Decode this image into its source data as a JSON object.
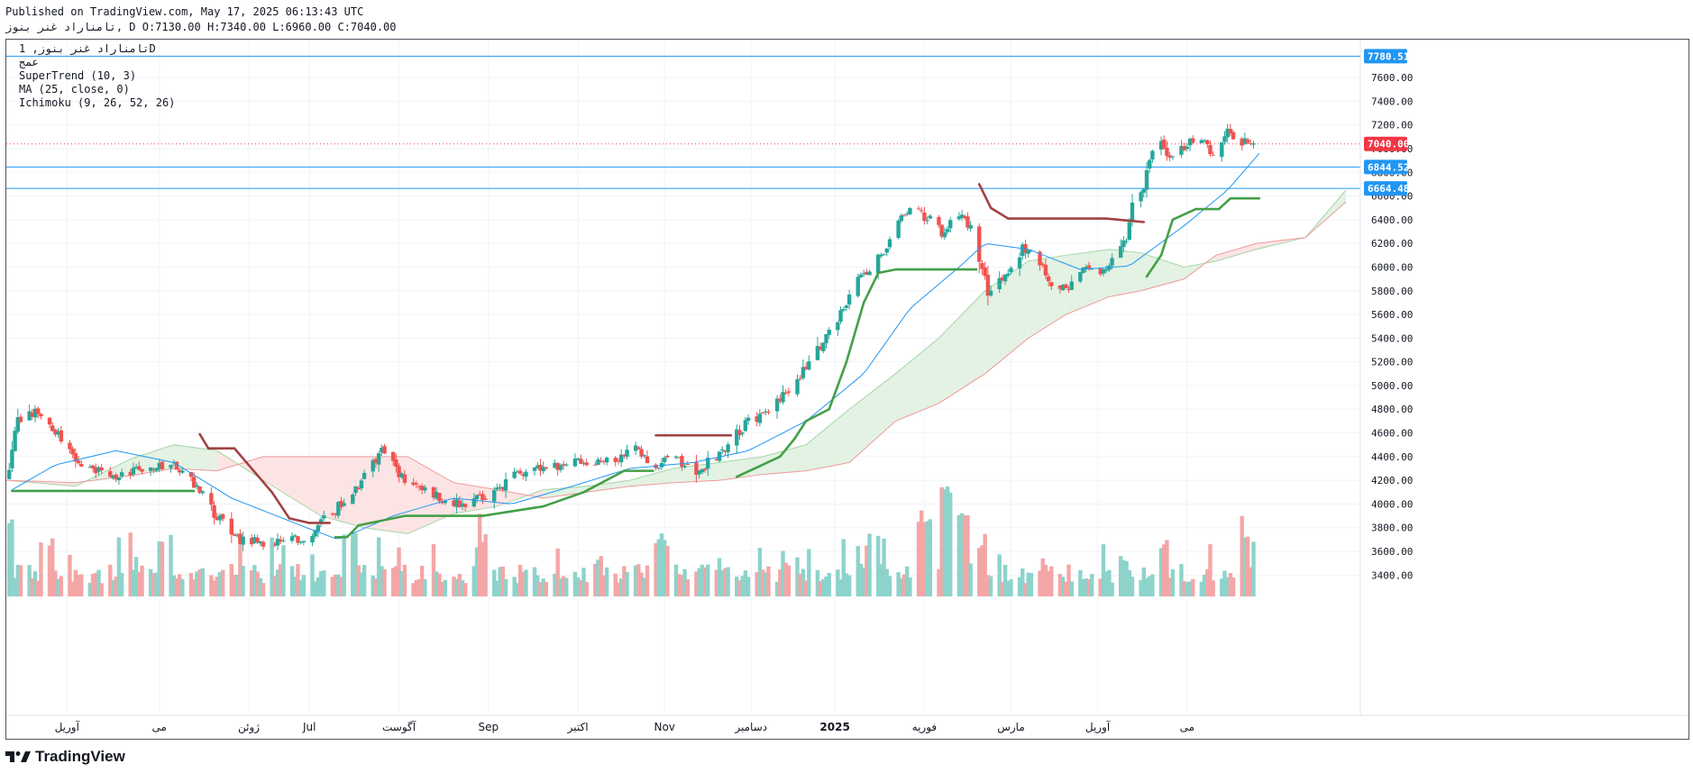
{
  "header": {
    "published": "Published on TradingView.com, May 17, 2025 06:13:43 UTC",
    "ohlc": "تامناراد غنر بنوز, D O:7130.00 H:7340.00 L:6960.00 C:7040.00"
  },
  "legend": {
    "symbol": "تامناراد غنر بنوز, 1D",
    "exchange": "عمج",
    "supertrend": "SuperTrend (10, 3)",
    "ma": "MA (25, close, 0)",
    "ichimoku": "Ichimoku (9, 26, 52, 26)"
  },
  "brand": {
    "logo_text": "TradingView"
  },
  "colors": {
    "up": "#26a69a",
    "down": "#ef5350",
    "up_light": "#8dd3cb",
    "down_light": "#f4a6a6",
    "ma": "#2196f3",
    "supertrend_up": "#43a047",
    "supertrend_down": "#a04242",
    "cloud_green": "#e3f2e3",
    "cloud_red": "#fde4e4",
    "hline": "#2196f3",
    "last_price": "#f23645"
  },
  "chart_data": {
    "type": "candlestick",
    "ylim": [
      3220,
      7920
    ],
    "y_ticks": [
      3400,
      3600,
      3800,
      4000,
      4200,
      4400,
      4600,
      4800,
      5000,
      5200,
      5400,
      5600,
      5800,
      6000,
      6200,
      6400,
      6600,
      6800,
      7000,
      7200,
      7400,
      7600
    ],
    "x_range": [
      "2024-03-08",
      "2025-06-20"
    ],
    "x_ticks": [
      {
        "label": "آوریل",
        "date": "2024-03-29"
      },
      {
        "label": "می",
        "date": "2024-04-30"
      },
      {
        "label": "ژوئن",
        "date": "2024-05-31"
      },
      {
        "label": "Jul",
        "date": "2024-06-21"
      },
      {
        "label": "آگوست",
        "date": "2024-07-22"
      },
      {
        "label": "Sep",
        "date": "2024-08-22"
      },
      {
        "label": "اکتبر",
        "date": "2024-09-22"
      },
      {
        "label": "Nov",
        "date": "2024-10-22"
      },
      {
        "label": "دسامبر",
        "date": "2024-11-21"
      },
      {
        "label": "2025",
        "date": "2024-12-20"
      },
      {
        "label": "فوریه",
        "date": "2025-01-20"
      },
      {
        "label": "مارس",
        "date": "2025-02-19"
      },
      {
        "label": "آوریل",
        "date": "2025-03-21"
      },
      {
        "label": "می",
        "date": "2025-04-21"
      }
    ],
    "price_anchors": [
      [
        "2024-03-08",
        4200
      ],
      [
        "2024-03-12",
        4700
      ],
      [
        "2024-03-20",
        4780
      ],
      [
        "2024-03-28",
        4500
      ],
      [
        "2024-04-05",
        4300
      ],
      [
        "2024-04-15",
        4230
      ],
      [
        "2024-04-25",
        4300
      ],
      [
        "2024-05-05",
        4350
      ],
      [
        "2024-05-10",
        4250
      ],
      [
        "2024-05-18",
        3950
      ],
      [
        "2024-05-28",
        3700
      ],
      [
        "2024-06-08",
        3650
      ],
      [
        "2024-06-20",
        3730
      ],
      [
        "2024-06-30",
        3950
      ],
      [
        "2024-07-08",
        4150
      ],
      [
        "2024-07-16",
        4450
      ],
      [
        "2024-07-24",
        4200
      ],
      [
        "2024-08-01",
        4090
      ],
      [
        "2024-08-12",
        4000
      ],
      [
        "2024-08-22",
        4080
      ],
      [
        "2024-09-01",
        4250
      ],
      [
        "2024-09-12",
        4320
      ],
      [
        "2024-09-24",
        4350
      ],
      [
        "2024-10-06",
        4400
      ],
      [
        "2024-10-12",
        4500
      ],
      [
        "2024-10-17",
        4320
      ],
      [
        "2024-10-24",
        4380
      ],
      [
        "2024-11-03",
        4280
      ],
      [
        "2024-11-12",
        4480
      ],
      [
        "2024-11-20",
        4700
      ],
      [
        "2024-11-28",
        4800
      ],
      [
        "2024-12-03",
        4950
      ],
      [
        "2024-12-08",
        5100
      ],
      [
        "2024-12-13",
        5250
      ],
      [
        "2024-12-18",
        5450
      ],
      [
        "2024-12-24",
        5700
      ],
      [
        "2024-12-28",
        5900
      ],
      [
        "2025-01-01",
        6000
      ],
      [
        "2025-01-06",
        6150
      ],
      [
        "2025-01-10",
        6350
      ],
      [
        "2025-01-16",
        6500
      ],
      [
        "2025-01-22",
        6400
      ],
      [
        "2025-01-26",
        6300
      ],
      [
        "2025-02-01",
        6450
      ],
      [
        "2025-02-05",
        6350
      ],
      [
        "2025-02-08",
        6050
      ],
      [
        "2025-02-11",
        5800
      ],
      [
        "2025-02-18",
        5950
      ],
      [
        "2025-02-23",
        6150
      ],
      [
        "2025-02-28",
        6100
      ],
      [
        "2025-03-05",
        5850
      ],
      [
        "2025-03-11",
        5800
      ],
      [
        "2025-03-17",
        6000
      ],
      [
        "2025-03-22",
        5950
      ],
      [
        "2025-03-28",
        6100
      ],
      [
        "2025-03-31",
        6250
      ],
      [
        "2025-04-02",
        6500
      ],
      [
        "2025-04-05",
        6600
      ],
      [
        "2025-04-10",
        7100
      ],
      [
        "2025-04-15",
        6900
      ],
      [
        "2025-04-20",
        7000
      ],
      [
        "2025-04-25",
        7100
      ],
      [
        "2025-04-30",
        6950
      ],
      [
        "2025-05-05",
        7150
      ],
      [
        "2025-05-10",
        7050
      ],
      [
        "2025-05-16",
        7040
      ]
    ],
    "last_candle": {
      "date": "2025-05-16",
      "open": 7130,
      "high": 7340,
      "low": 6960,
      "close": 7040
    },
    "horizontal_lines": [
      7780.51,
      6844.52,
      6664.48
    ],
    "price_labels": [
      {
        "text": "7780.51",
        "value": 7780.51,
        "kind": "hline"
      },
      {
        "text": "7040.00",
        "value": 7040,
        "kind": "last"
      },
      {
        "text": "6844.52",
        "value": 6844.52,
        "kind": "hline"
      },
      {
        "text": "6664.48",
        "value": 6664.48,
        "kind": "hline"
      }
    ],
    "last_price": 7040,
    "supertrend_anchors": [
      [
        "2024-03-10",
        4110,
        "up"
      ],
      [
        "2024-05-12",
        4110,
        "up"
      ],
      [
        "2024-05-14",
        4590,
        "down"
      ],
      [
        "2024-05-17",
        4470,
        "down"
      ],
      [
        "2024-05-26",
        4470,
        "down"
      ],
      [
        "2024-06-08",
        4100,
        "down"
      ],
      [
        "2024-06-14",
        3880,
        "down"
      ],
      [
        "2024-06-21",
        3840,
        "down"
      ],
      [
        "2024-06-28",
        3840,
        "down"
      ],
      [
        "2024-06-30",
        3720,
        "up"
      ],
      [
        "2024-07-04",
        3720,
        "up"
      ],
      [
        "2024-07-08",
        3820,
        "up"
      ],
      [
        "2024-07-24",
        3900,
        "up"
      ],
      [
        "2024-08-20",
        3900,
        "up"
      ],
      [
        "2024-09-10",
        3980,
        "up"
      ],
      [
        "2024-09-24",
        4100,
        "up"
      ],
      [
        "2024-10-08",
        4280,
        "up"
      ],
      [
        "2024-10-18",
        4280,
        "up"
      ],
      [
        "2024-10-19",
        4580,
        "down"
      ],
      [
        "2024-11-14",
        4580,
        "down"
      ],
      [
        "2024-11-16",
        4230,
        "up"
      ],
      [
        "2024-11-24",
        4320,
        "up"
      ],
      [
        "2024-12-01",
        4400,
        "up"
      ],
      [
        "2024-12-06",
        4550,
        "up"
      ],
      [
        "2024-12-10",
        4700,
        "up"
      ],
      [
        "2024-12-18",
        4800,
        "up"
      ],
      [
        "2024-12-24",
        5200,
        "up"
      ],
      [
        "2024-12-30",
        5700,
        "up"
      ],
      [
        "2025-01-04",
        5950,
        "up"
      ],
      [
        "2025-01-10",
        5980,
        "up"
      ],
      [
        "2025-02-07",
        5980,
        "up"
      ],
      [
        "2025-02-08",
        6700,
        "down"
      ],
      [
        "2025-02-12",
        6500,
        "down"
      ],
      [
        "2025-02-18",
        6410,
        "down"
      ],
      [
        "2025-03-24",
        6410,
        "down"
      ],
      [
        "2025-04-06",
        6380,
        "down"
      ],
      [
        "2025-04-07",
        5920,
        "up"
      ],
      [
        "2025-04-12",
        6100,
        "up"
      ],
      [
        "2025-04-16",
        6400,
        "up"
      ],
      [
        "2025-04-24",
        6490,
        "up"
      ],
      [
        "2025-05-02",
        6490,
        "up"
      ],
      [
        "2025-05-06",
        6580,
        "up"
      ],
      [
        "2025-05-16",
        6580,
        "up"
      ]
    ],
    "ma_anchors": [
      [
        "2024-03-10",
        4120
      ],
      [
        "2024-03-25",
        4330
      ],
      [
        "2024-04-15",
        4450
      ],
      [
        "2024-05-05",
        4350
      ],
      [
        "2024-05-25",
        4050
      ],
      [
        "2024-06-20",
        3800
      ],
      [
        "2024-07-01",
        3700
      ],
      [
        "2024-07-20",
        3900
      ],
      [
        "2024-08-10",
        4050
      ],
      [
        "2024-08-30",
        4000
      ],
      [
        "2024-09-20",
        4150
      ],
      [
        "2024-10-10",
        4300
      ],
      [
        "2024-11-01",
        4350
      ],
      [
        "2024-11-20",
        4450
      ],
      [
        "2024-12-10",
        4700
      ],
      [
        "2024-12-30",
        5100
      ],
      [
        "2025-01-15",
        5650
      ],
      [
        "2025-02-01",
        6000
      ],
      [
        "2025-02-10",
        6200
      ],
      [
        "2025-02-25",
        6150
      ],
      [
        "2025-03-15",
        5980
      ],
      [
        "2025-04-01",
        6010
      ],
      [
        "2025-04-20",
        6350
      ],
      [
        "2025-05-05",
        6650
      ],
      [
        "2025-05-16",
        6960
      ]
    ],
    "cloud_anchors": [
      [
        "2024-03-08",
        4200,
        4200
      ],
      [
        "2024-04-01",
        4150,
        4180
      ],
      [
        "2024-04-20",
        4380,
        4240
      ],
      [
        "2024-05-05",
        4500,
        4300
      ],
      [
        "2024-05-20",
        4450,
        4280
      ],
      [
        "2024-06-05",
        4200,
        4400
      ],
      [
        "2024-06-25",
        3900,
        4400
      ],
      [
        "2024-07-10",
        3800,
        4400
      ],
      [
        "2024-07-25",
        3750,
        4400
      ],
      [
        "2024-08-10",
        3920,
        4180
      ],
      [
        "2024-08-25",
        3980,
        4120
      ],
      [
        "2024-09-10",
        4120,
        4050
      ],
      [
        "2024-09-25",
        4150,
        4100
      ],
      [
        "2024-10-10",
        4200,
        4150
      ],
      [
        "2024-10-25",
        4300,
        4180
      ],
      [
        "2024-11-10",
        4350,
        4200
      ],
      [
        "2024-11-25",
        4400,
        4250
      ],
      [
        "2024-12-10",
        4500,
        4280
      ],
      [
        "2024-12-25",
        4800,
        4350
      ],
      [
        "2025-01-10",
        5100,
        4700
      ],
      [
        "2025-01-25",
        5400,
        4850
      ],
      [
        "2025-02-10",
        5800,
        5100
      ],
      [
        "2025-02-25",
        6050,
        5400
      ],
      [
        "2025-03-10",
        6100,
        5600
      ],
      [
        "2025-03-25",
        6150,
        5750
      ],
      [
        "2025-04-05",
        6120,
        5800
      ],
      [
        "2025-04-20",
        6000,
        5900
      ],
      [
        "2025-05-01",
        6050,
        6100
      ],
      [
        "2025-05-15",
        6150,
        6200
      ],
      [
        "2025-06-01",
        6250,
        6250
      ],
      [
        "2025-06-15",
        6650,
        6550
      ]
    ],
    "volume_peaks": [
      [
        "2024-03-08",
        3
      ],
      [
        "2024-03-22",
        2
      ],
      [
        "2024-04-20",
        1
      ],
      [
        "2024-05-02",
        2
      ],
      [
        "2024-06-01",
        1
      ],
      [
        "2024-07-05",
        2
      ],
      [
        "2024-08-20",
        2
      ],
      [
        "2024-09-28",
        1
      ],
      [
        "2024-10-20",
        2
      ],
      [
        "2024-11-10",
        1
      ],
      [
        "2024-12-05",
        1
      ],
      [
        "2025-01-02",
        2
      ],
      [
        "2025-01-20",
        3
      ],
      [
        "2025-01-28",
        4
      ],
      [
        "2025-02-02",
        3
      ],
      [
        "2025-02-08",
        2
      ],
      [
        "2025-03-01",
        1
      ],
      [
        "2025-03-30",
        1
      ],
      [
        "2025-04-12",
        2
      ],
      [
        "2025-05-10",
        2
      ]
    ]
  }
}
